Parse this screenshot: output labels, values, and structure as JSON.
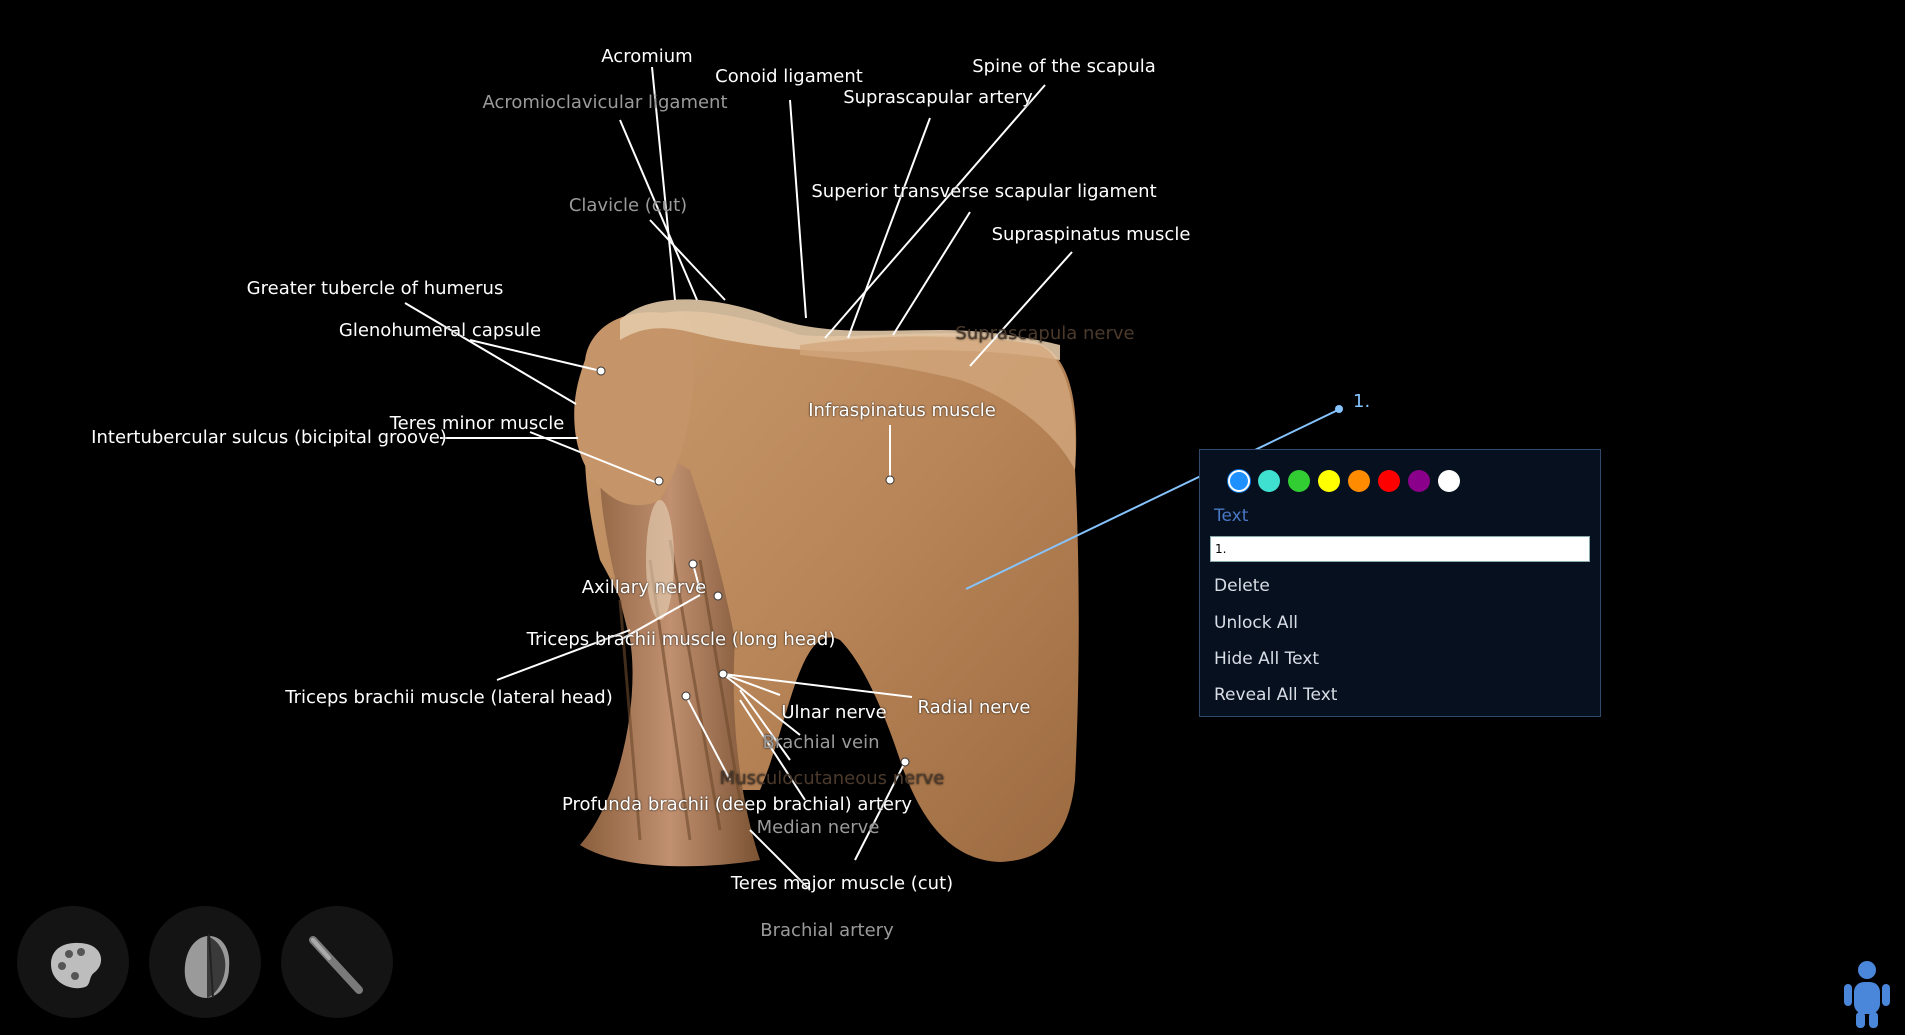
{
  "labels": {
    "acromium": "Acromium",
    "acromioclavicular_ligament": "Acromioclavicular ligament",
    "conoid_ligament": "Conoid ligament",
    "spine_of_scapula": "Spine of the scapula",
    "suprascapular_artery": "Suprascapular artery",
    "superior_transverse_scapular_ligament": "Superior transverse scapular ligament",
    "clavicle_cut": "Clavicle (cut)",
    "supraspinatus_muscle": "Supraspinatus muscle",
    "greater_tubercle": "Greater tubercle of humerus",
    "glenohumeral_capsule": "Glenohumeral capsule",
    "suprascapula_nerve": "Suprascapula nerve",
    "teres_minor": "Teres minor muscle",
    "intertubercular_sulcus": "Intertubercular sulcus (bicipital groove)",
    "infraspinatus": "Infraspinatus muscle",
    "axillary_nerve": "Axillary nerve",
    "triceps_long": "Triceps brachii muscle (long head)",
    "triceps_lateral": "Triceps brachii muscle (lateral head)",
    "ulnar_nerve": "Ulnar nerve",
    "radial_nerve": "Radial nerve",
    "brachial_vein": "Brachial vein",
    "musculocutaneous_nerve": "Musculocutaneous nerve",
    "profunda_brachii": "Profunda brachii (deep brachial) artery",
    "median_nerve": "Median nerve",
    "teres_major": "Teres major muscle (cut)",
    "brachial_artery": "Brachial artery",
    "marker": "1."
  },
  "panel": {
    "colors": [
      "#1e90ff",
      "#40e0d0",
      "#32cd32",
      "#ffff00",
      "#ff8c00",
      "#ff0000",
      "#8b008b",
      "#ffffff"
    ],
    "selected_color": "#1e90ff",
    "heading": "Text",
    "input_value": "1.",
    "menu": [
      "Delete",
      "Unlock All",
      "Hide All Text",
      "Reveal All Text"
    ]
  },
  "toolbar": {
    "icons": [
      "palette-icon",
      "head-section-icon",
      "scalpel-icon"
    ],
    "figure_icon": "figure-icon"
  }
}
